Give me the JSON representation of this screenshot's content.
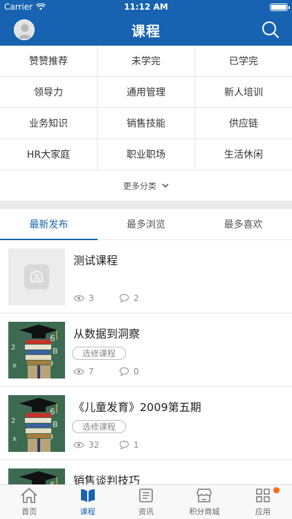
{
  "status": {
    "carrier": "Carrier",
    "time": "11:12 AM"
  },
  "nav": {
    "title": "课程"
  },
  "categories": [
    "赞赞推荐",
    "未学完",
    "已学完",
    "领导力",
    "通用管理",
    "新人培训",
    "业务知识",
    "销售技能",
    "供应链",
    "HR大家庭",
    "职业职场",
    "生活休闲"
  ],
  "more": {
    "label": "更多分类"
  },
  "tabs": [
    "最新发布",
    "最多浏览",
    "最多喜欢"
  ],
  "courses": [
    {
      "title": "测试课程",
      "tag": "",
      "views": "3",
      "comments": "2",
      "thumb": "placeholder"
    },
    {
      "title": "从数据到洞察",
      "tag": "选修课程",
      "views": "7",
      "comments": "0",
      "thumb": "graduation-books"
    },
    {
      "title": "《儿童发育》2009第五期",
      "tag": "选修课程",
      "views": "32",
      "comments": "1",
      "thumb": "graduation-books"
    },
    {
      "title": "销售谈判技巧",
      "tag": "",
      "views": "",
      "comments": "",
      "thumb": "graduation-books"
    }
  ],
  "tabbar": [
    {
      "label": "首页",
      "icon": "home-icon"
    },
    {
      "label": "课程",
      "icon": "course-book-icon"
    },
    {
      "label": "资讯",
      "icon": "news-icon"
    },
    {
      "label": "积分商城",
      "icon": "store-icon"
    },
    {
      "label": "应用",
      "icon": "apps-grid-icon"
    }
  ],
  "colors": {
    "primary": "#1763b1",
    "badge": "#ff6a1a"
  }
}
